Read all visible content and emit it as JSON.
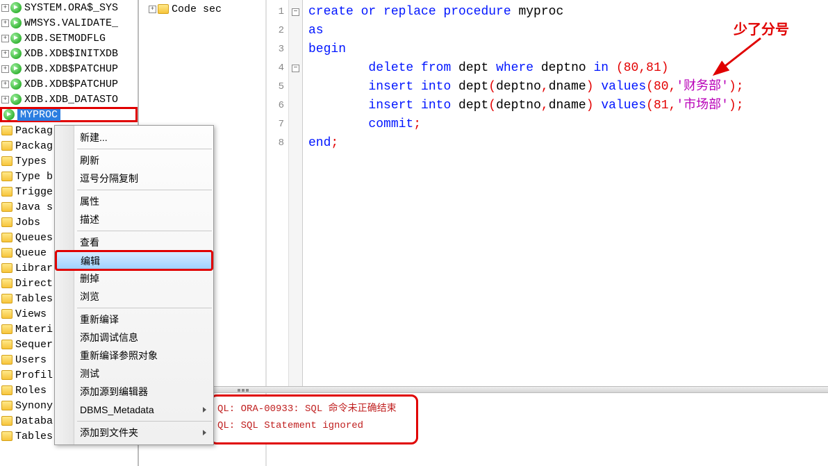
{
  "tree": {
    "procs": [
      "SYSTEM.ORA$_SYS",
      "WMSYS.VALIDATE_",
      "XDB.SETMODFLG",
      "XDB.XDB$INITXDB",
      "XDB.XDB$PATCHUP",
      "XDB.XDB$PATCHUP",
      "XDB.XDB_DATASTO"
    ],
    "selected": "MYPROC",
    "folders": [
      "Packag",
      "Packag",
      "Types",
      "Type b",
      "Trigge",
      "Java s",
      "Jobs",
      "Queues",
      "Queue",
      "Librar",
      "Direct",
      "Tables",
      "Views",
      "Materi",
      "Sequer",
      "Users",
      "Profil",
      "Roles",
      "Synony",
      "Databa",
      "Tables"
    ]
  },
  "middle": {
    "codesec": "Code sec"
  },
  "code": {
    "l1_kw1": "create or replace procedure",
    "l1_ident": " myproc",
    "l2": "as",
    "l3": "begin",
    "l4_indent": "        ",
    "l4_kw": "delete from",
    "l4_t": " dept ",
    "l4_kw2": "where",
    "l4_t2": " deptno ",
    "l4_kw3": "in",
    "l4_p1": " (",
    "l4_n1": "80",
    "l4_c": ",",
    "l4_n2": "81",
    "l4_p2": ")",
    "l5_indent": "        ",
    "l5_kw": "insert into",
    "l5_t": " dept",
    "l5_p1": "(",
    "l5_c1": "deptno",
    "l5_cm": ",",
    "l5_c2": "dname",
    "l5_p2": ") ",
    "l5_kw2": "values",
    "l5_p3": "(",
    "l5_n": "80",
    "l5_cm2": ",",
    "l5_s": "'财务部'",
    "l5_p4": ");",
    "l6_indent": "        ",
    "l6_kw": "insert into",
    "l6_t": " dept",
    "l6_p1": "(",
    "l6_c1": "deptno",
    "l6_cm": ",",
    "l6_c2": "dname",
    "l6_p2": ") ",
    "l6_kw2": "values",
    "l6_p3": "(",
    "l6_n": "81",
    "l6_cm2": ",",
    "l6_s": "'市场部'",
    "l6_p4": ");",
    "l7_indent": "        ",
    "l7_kw": "commit",
    "l7_sc": ";",
    "l8_kw": "end",
    "l8_sc": ";"
  },
  "lineNumbers": [
    "1",
    "2",
    "3",
    "4",
    "5",
    "6",
    "7",
    "8"
  ],
  "error": {
    "l1": "QL: ORA-00933: SQL 命令未正确结束",
    "l2": "QL: SQL Statement ignored"
  },
  "menu": {
    "items": [
      {
        "label": "新建...",
        "type": "item"
      },
      {
        "type": "sep"
      },
      {
        "label": "刷新",
        "type": "item"
      },
      {
        "label": "逗号分隔复制",
        "type": "item"
      },
      {
        "type": "sep"
      },
      {
        "label": "属性",
        "type": "item"
      },
      {
        "label": "描述",
        "type": "item"
      },
      {
        "type": "sep"
      },
      {
        "label": "查看",
        "type": "item"
      },
      {
        "label": "编辑",
        "type": "item",
        "highlight": true,
        "redbox": true
      },
      {
        "label": "删掉",
        "type": "item"
      },
      {
        "label": "浏览",
        "type": "item"
      },
      {
        "type": "sep"
      },
      {
        "label": "重新编译",
        "type": "item"
      },
      {
        "label": "添加调试信息",
        "type": "item"
      },
      {
        "label": "重新编译参照对象",
        "type": "item"
      },
      {
        "label": "测试",
        "type": "item"
      },
      {
        "label": "添加源到编辑器",
        "type": "item"
      },
      {
        "label": "DBMS_Metadata",
        "type": "item",
        "submenu": true
      },
      {
        "type": "sep"
      },
      {
        "label": "添加到文件夹",
        "type": "item",
        "submenu": true
      }
    ]
  },
  "annotation": {
    "text": "少了分号"
  }
}
